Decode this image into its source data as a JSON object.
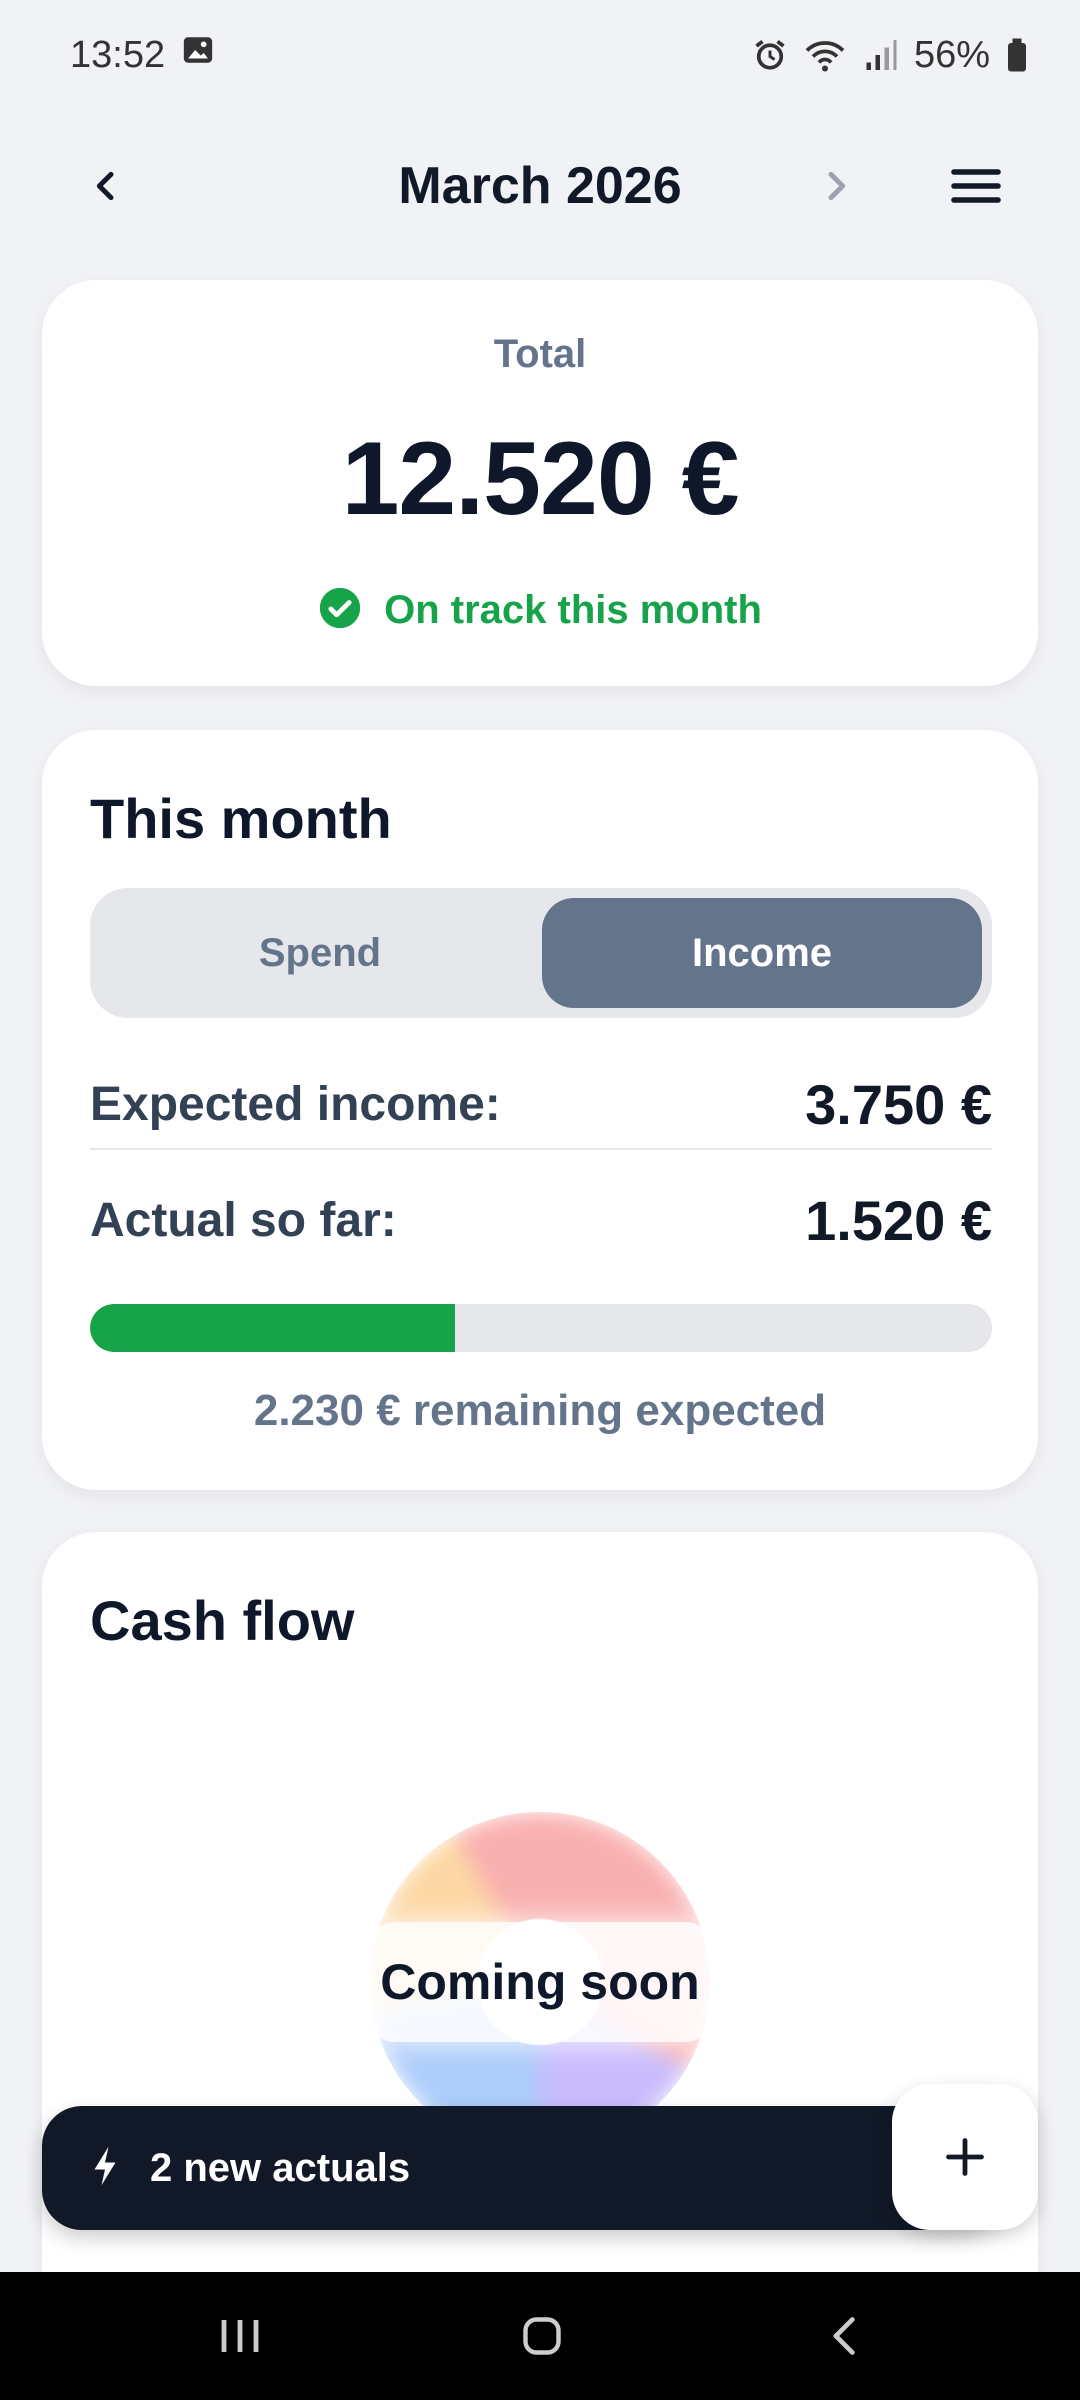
{
  "status_bar": {
    "time": "13:52",
    "battery": "56%",
    "icons": [
      "image-icon",
      "alarm-icon",
      "wifi-icon",
      "signal-icon",
      "battery-icon"
    ]
  },
  "header": {
    "title": "March 2026",
    "prev_icon": "chevron-left-icon",
    "next_icon": "chevron-right-icon",
    "menu_icon": "hamburger-menu-icon"
  },
  "total_card": {
    "label": "Total",
    "value": "12.520 €",
    "status": "On track this month",
    "status_color": "#16a34a"
  },
  "month_card": {
    "title": "This month",
    "toggle": {
      "options": [
        "Spend",
        "Income"
      ],
      "selected": "Income"
    },
    "expected_label": "Expected income:",
    "expected_value": "3.750 €",
    "actual_label": "Actual so far:",
    "actual_value": "1.520 €",
    "progress_percent": 40.5,
    "remaining_text": "2.230 € remaining expected"
  },
  "cash_flow_card": {
    "title": "Cash flow",
    "overlay": "Coming soon"
  },
  "actuals_bar": {
    "icon": "lightning-icon",
    "text": "2 new actuals"
  },
  "fab": {
    "icon": "plus-icon"
  },
  "colors": {
    "accent_green": "#16a34a",
    "toggle_active": "#64748b",
    "dark_bar": "#111827",
    "background": "#f1f2f5"
  }
}
